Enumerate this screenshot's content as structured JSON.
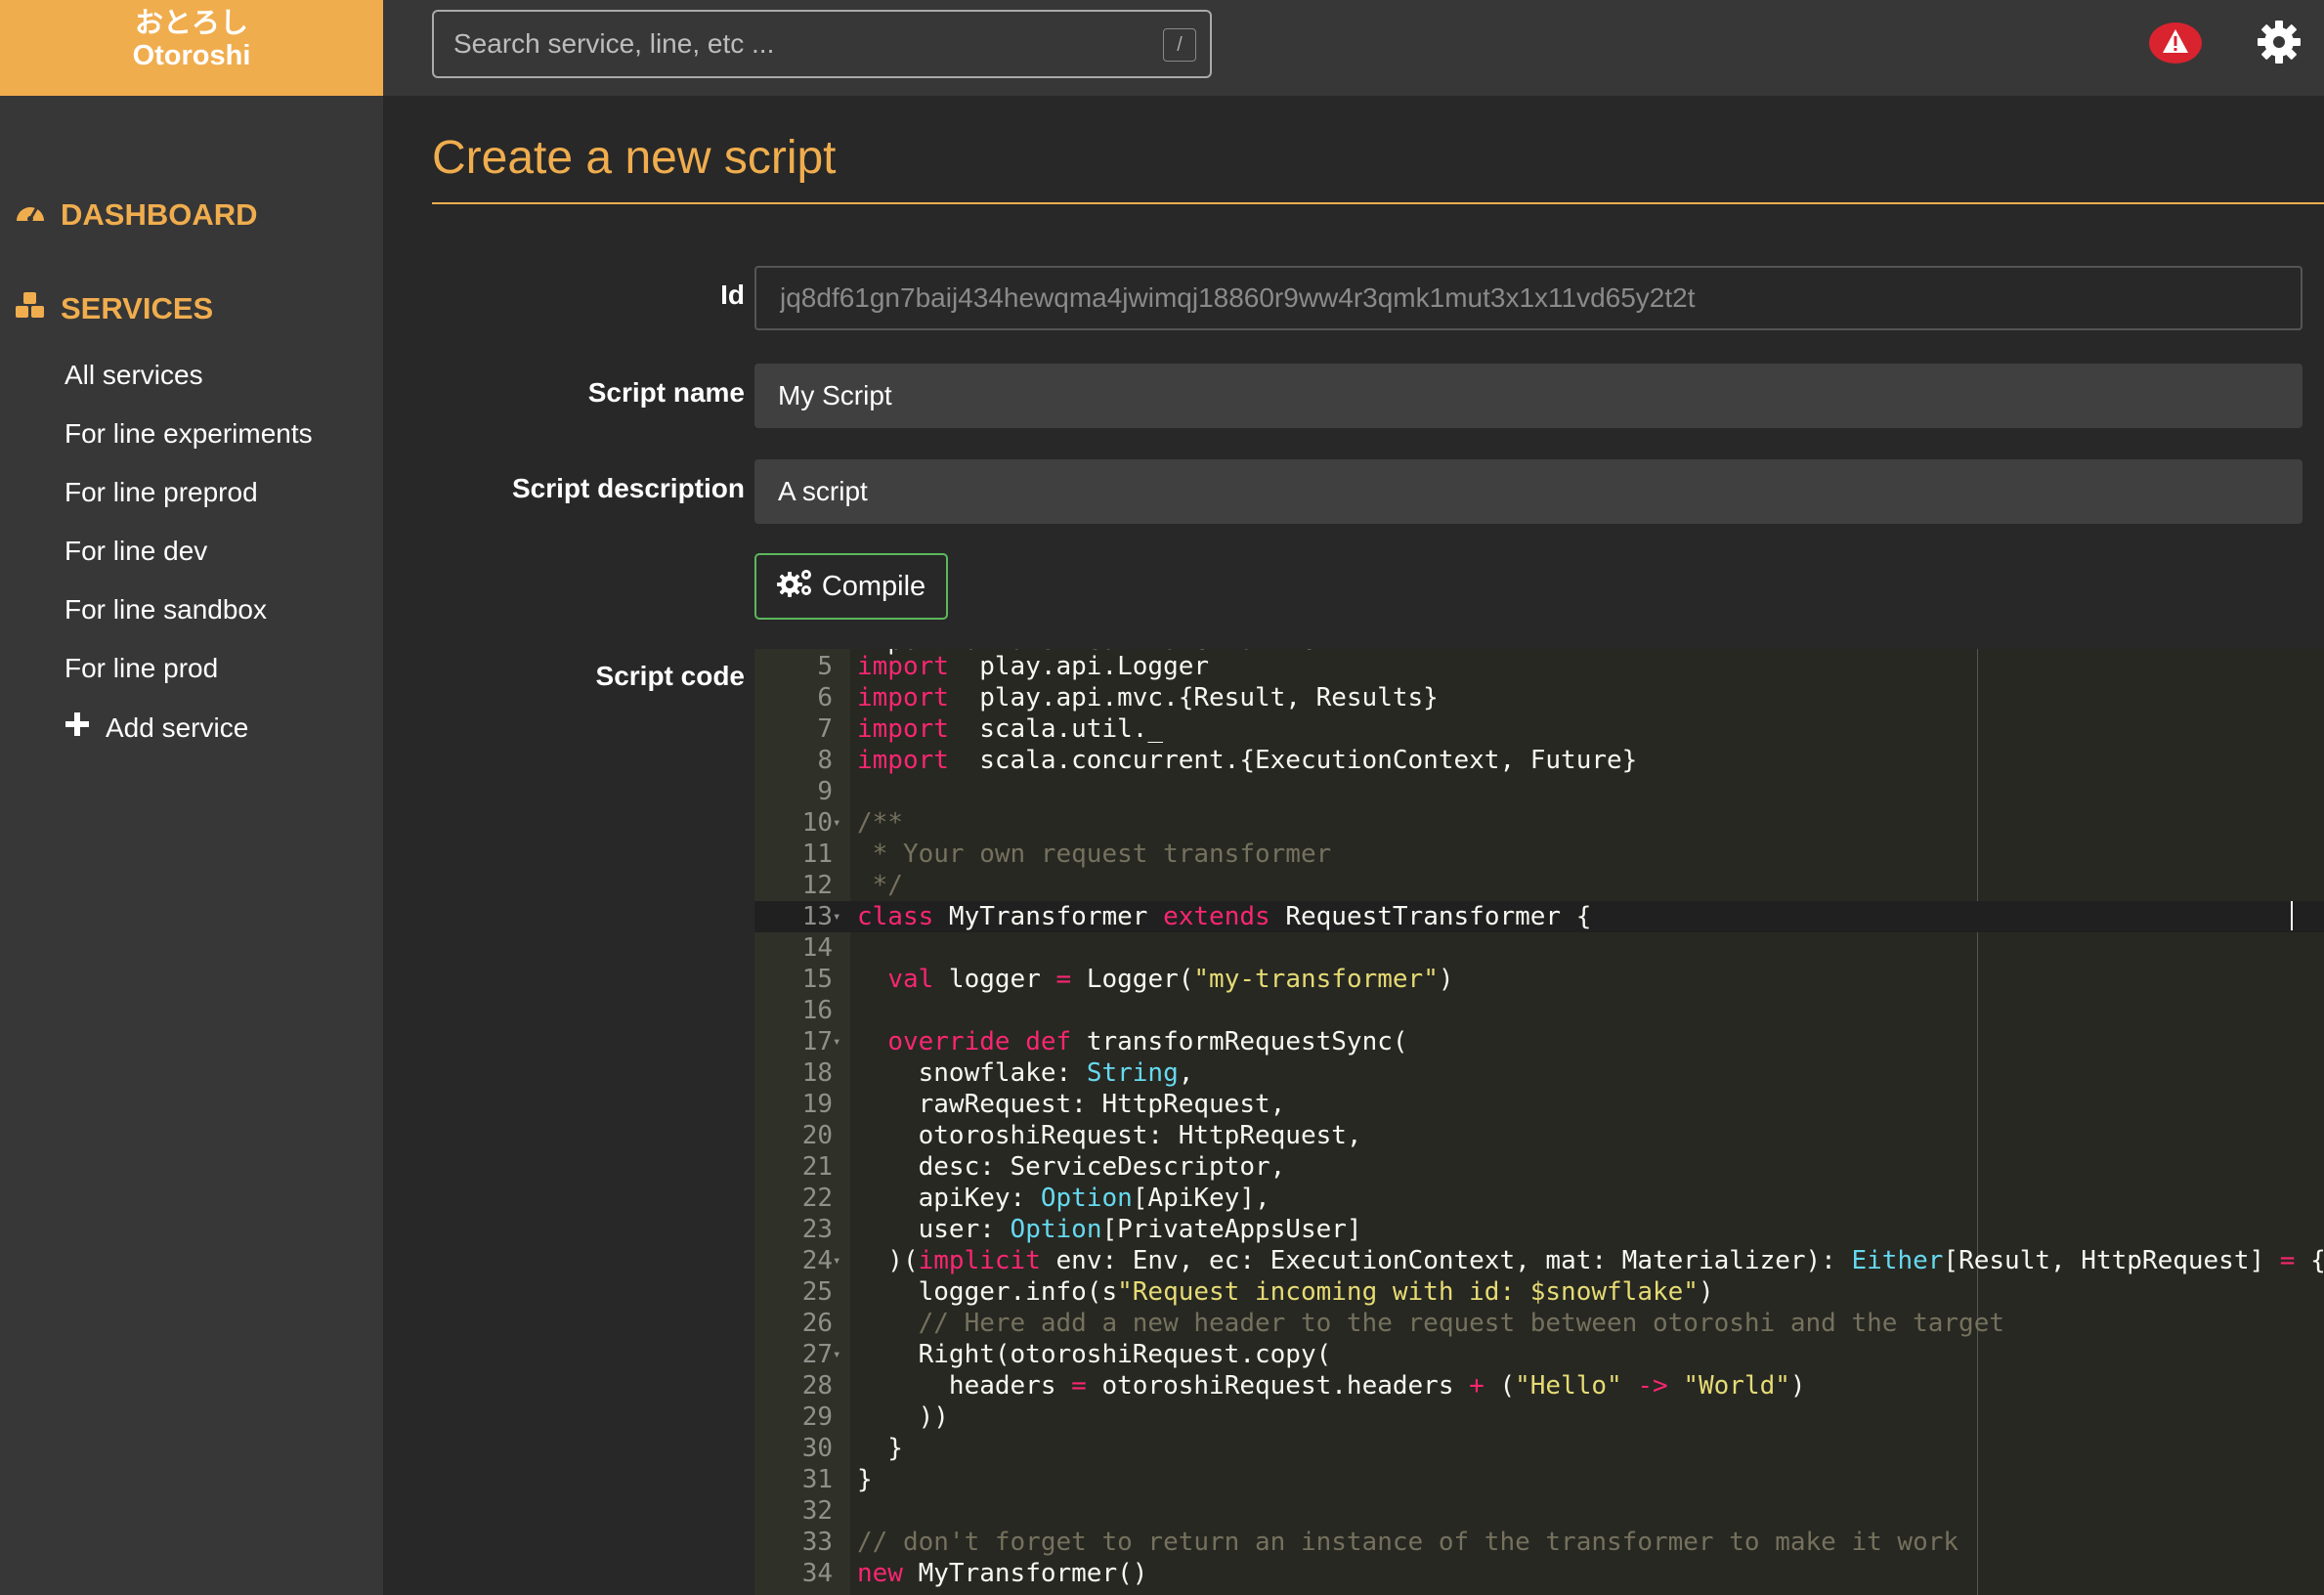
{
  "brand": {
    "japanese": "おとろし",
    "name": "Otoroshi",
    "color": "#f0ad4e"
  },
  "search": {
    "placeholder": "Search service, line, etc ...",
    "shortcut": "/"
  },
  "header_icons": [
    "alert-icon",
    "gear-icon"
  ],
  "sidebar": {
    "dashboard": {
      "icon": "dashboard-icon",
      "label": "DASHBOARD"
    },
    "services": {
      "icon": "cubes-icon",
      "label": "SERVICES"
    },
    "items": [
      {
        "label": "All services"
      },
      {
        "label": "For line experiments"
      },
      {
        "label": "For line preprod"
      },
      {
        "label": "For line dev"
      },
      {
        "label": "For line sandbox"
      },
      {
        "label": "For line prod"
      }
    ],
    "add_service": {
      "icon": "plus-icon",
      "label": "Add service"
    }
  },
  "page": {
    "title": "Create a new script"
  },
  "form": {
    "id": {
      "label": "Id",
      "value": "jq8df61gn7baij434hewqma4jwimqj18860r9ww4r3qmk1mut3x1x11vd65y2t2t"
    },
    "name": {
      "label": "Script name",
      "value": "My Script"
    },
    "description": {
      "label": "Script description",
      "value": "A script"
    },
    "compile_button": {
      "icon": "gears-icon",
      "label": "Compile"
    },
    "code_label": "Script code"
  },
  "editor": {
    "active_line": 13,
    "partial_top_line": "import akka.stream.Materializer",
    "lines": [
      {
        "n": 5,
        "fold": false,
        "tokens": [
          [
            "kw",
            "import"
          ],
          [
            "",
            "  play.api.Logger"
          ]
        ]
      },
      {
        "n": 6,
        "fold": false,
        "tokens": [
          [
            "kw",
            "import"
          ],
          [
            "",
            "  play.api.mvc.{Result, Results}"
          ]
        ]
      },
      {
        "n": 7,
        "fold": false,
        "tokens": [
          [
            "kw",
            "import"
          ],
          [
            "",
            "  scala.util._"
          ]
        ]
      },
      {
        "n": 8,
        "fold": false,
        "tokens": [
          [
            "kw",
            "import"
          ],
          [
            "",
            "  scala.concurrent.{ExecutionContext, Future}"
          ]
        ]
      },
      {
        "n": 9,
        "fold": false,
        "tokens": []
      },
      {
        "n": 10,
        "fold": true,
        "tokens": [
          [
            "cmt",
            "/**"
          ]
        ]
      },
      {
        "n": 11,
        "fold": false,
        "tokens": [
          [
            "cmt",
            " * Your own request transformer"
          ]
        ]
      },
      {
        "n": 12,
        "fold": false,
        "tokens": [
          [
            "cmt",
            " */"
          ]
        ]
      },
      {
        "n": 13,
        "fold": true,
        "tokens": [
          [
            "kw",
            "class"
          ],
          [
            "",
            " MyTransformer "
          ],
          [
            "kw",
            "extends"
          ],
          [
            "",
            " RequestTransformer {"
          ]
        ]
      },
      {
        "n": 14,
        "fold": false,
        "tokens": []
      },
      {
        "n": 15,
        "fold": false,
        "tokens": [
          [
            "",
            "  "
          ],
          [
            "kw",
            "val"
          ],
          [
            "",
            " logger "
          ],
          [
            "kw",
            "="
          ],
          [
            "",
            " Logger("
          ],
          [
            "str",
            "\"my-transformer\""
          ],
          [
            "",
            ")"
          ]
        ]
      },
      {
        "n": 16,
        "fold": false,
        "tokens": []
      },
      {
        "n": 17,
        "fold": true,
        "tokens": [
          [
            "",
            "  "
          ],
          [
            "kw",
            "override"
          ],
          [
            "",
            " "
          ],
          [
            "kw",
            "def"
          ],
          [
            "",
            " transformRequestSync("
          ]
        ]
      },
      {
        "n": 18,
        "fold": false,
        "tokens": [
          [
            "",
            "    snowflake: "
          ],
          [
            "typ",
            "String"
          ],
          [
            "",
            ","
          ]
        ]
      },
      {
        "n": 19,
        "fold": false,
        "tokens": [
          [
            "",
            "    rawRequest: HttpRequest,"
          ]
        ]
      },
      {
        "n": 20,
        "fold": false,
        "tokens": [
          [
            "",
            "    otoroshiRequest: HttpRequest,"
          ]
        ]
      },
      {
        "n": 21,
        "fold": false,
        "tokens": [
          [
            "",
            "    desc: ServiceDescriptor,"
          ]
        ]
      },
      {
        "n": 22,
        "fold": false,
        "tokens": [
          [
            "",
            "    apiKey: "
          ],
          [
            "typ",
            "Option"
          ],
          [
            "",
            "[ApiKey],"
          ]
        ]
      },
      {
        "n": 23,
        "fold": false,
        "tokens": [
          [
            "",
            "    user: "
          ],
          [
            "typ",
            "Option"
          ],
          [
            "",
            "[PrivateAppsUser]"
          ]
        ]
      },
      {
        "n": 24,
        "fold": true,
        "tokens": [
          [
            "",
            "  )("
          ],
          [
            "kw",
            "implicit"
          ],
          [
            "",
            " env: Env, ec: ExecutionContext, mat: Materializer): "
          ],
          [
            "typ",
            "Either"
          ],
          [
            "",
            "[Result, HttpRequest] "
          ],
          [
            "kw",
            "="
          ],
          [
            "",
            " {"
          ]
        ]
      },
      {
        "n": 25,
        "fold": false,
        "tokens": [
          [
            "",
            "    logger.info(s"
          ],
          [
            "str",
            "\"Request incoming with id: $snowflake\""
          ],
          [
            "",
            ")"
          ]
        ]
      },
      {
        "n": 26,
        "fold": false,
        "tokens": [
          [
            "cmt",
            "    // Here add a new header to the request between otoroshi and the target"
          ]
        ]
      },
      {
        "n": 27,
        "fold": true,
        "tokens": [
          [
            "",
            "    Right(otoroshiRequest.copy("
          ]
        ]
      },
      {
        "n": 28,
        "fold": false,
        "tokens": [
          [
            "",
            "      headers "
          ],
          [
            "kw",
            "="
          ],
          [
            "",
            " otoroshiRequest.headers "
          ],
          [
            "kw",
            "+"
          ],
          [
            "",
            " ("
          ],
          [
            "str",
            "\"Hello\""
          ],
          [
            "",
            " "
          ],
          [
            "kw",
            "->"
          ],
          [
            "",
            " "
          ],
          [
            "str",
            "\"World\""
          ],
          [
            "",
            ")"
          ]
        ]
      },
      {
        "n": 29,
        "fold": false,
        "tokens": [
          [
            "",
            "    ))"
          ]
        ]
      },
      {
        "n": 30,
        "fold": false,
        "tokens": [
          [
            "",
            "  }"
          ]
        ]
      },
      {
        "n": 31,
        "fold": false,
        "tokens": [
          [
            "",
            "}"
          ]
        ]
      },
      {
        "n": 32,
        "fold": false,
        "tokens": []
      },
      {
        "n": 33,
        "fold": false,
        "tokens": [
          [
            "cmt",
            "// don't forget to return an instance of the transformer to make it work"
          ]
        ]
      },
      {
        "n": 34,
        "fold": false,
        "tokens": [
          [
            "kw",
            "new"
          ],
          [
            "",
            " MyTransformer()"
          ]
        ]
      }
    ]
  }
}
